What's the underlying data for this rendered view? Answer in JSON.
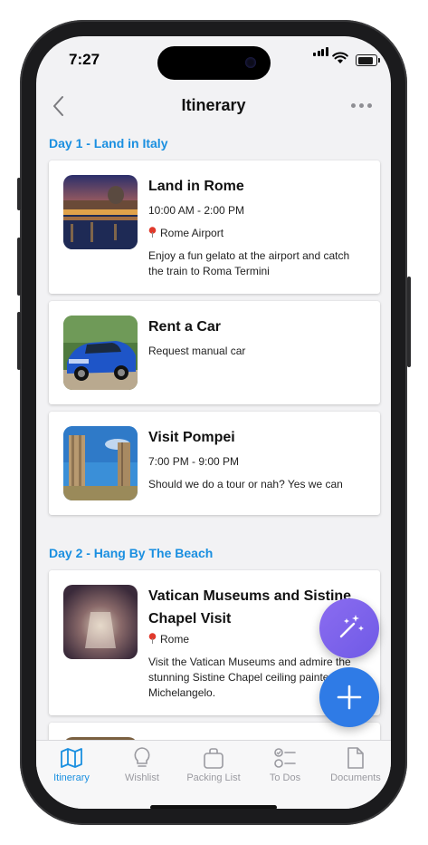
{
  "status_bar": {
    "time": "7:27"
  },
  "header": {
    "title": "Itinerary"
  },
  "days": [
    {
      "title": "Day 1 - Land in Italy",
      "items": [
        {
          "title": "Land in Rome",
          "time": "10:00 AM - 2:00 PM",
          "location": "Rome Airport",
          "note": "Enjoy a fun gelato at the airport and catch the train to Roma Termini"
        },
        {
          "title": "Rent a Car",
          "note": "Request manual car"
        },
        {
          "title": "Visit Pompei",
          "time": "7:00 PM - 9:00 PM",
          "note": "Should we do a tour or nah? Yes we can"
        }
      ]
    },
    {
      "title": "Day 2 - Hang By The Beach",
      "items": [
        {
          "title": "Vatican Museums and Sistine Chapel Visit",
          "location": "Rome",
          "note": "Visit the Vatican Museums and admire the stunning Sistine Chapel ceiling painted by Michelangelo."
        }
      ]
    }
  ],
  "tabs": [
    {
      "label": "Itinerary",
      "icon": "map-icon",
      "active": true
    },
    {
      "label": "Wishlist",
      "icon": "lightbulb-icon"
    },
    {
      "label": "Packing List",
      "icon": "bag-icon"
    },
    {
      "label": "To Dos",
      "icon": "checklist-icon"
    },
    {
      "label": "Documents",
      "icon": "document-icon"
    }
  ],
  "colors": {
    "accent": "#1a8fe0",
    "fab_magic": "#7b63ea",
    "fab_add": "#2f7be6",
    "pin": "#e0392b"
  }
}
